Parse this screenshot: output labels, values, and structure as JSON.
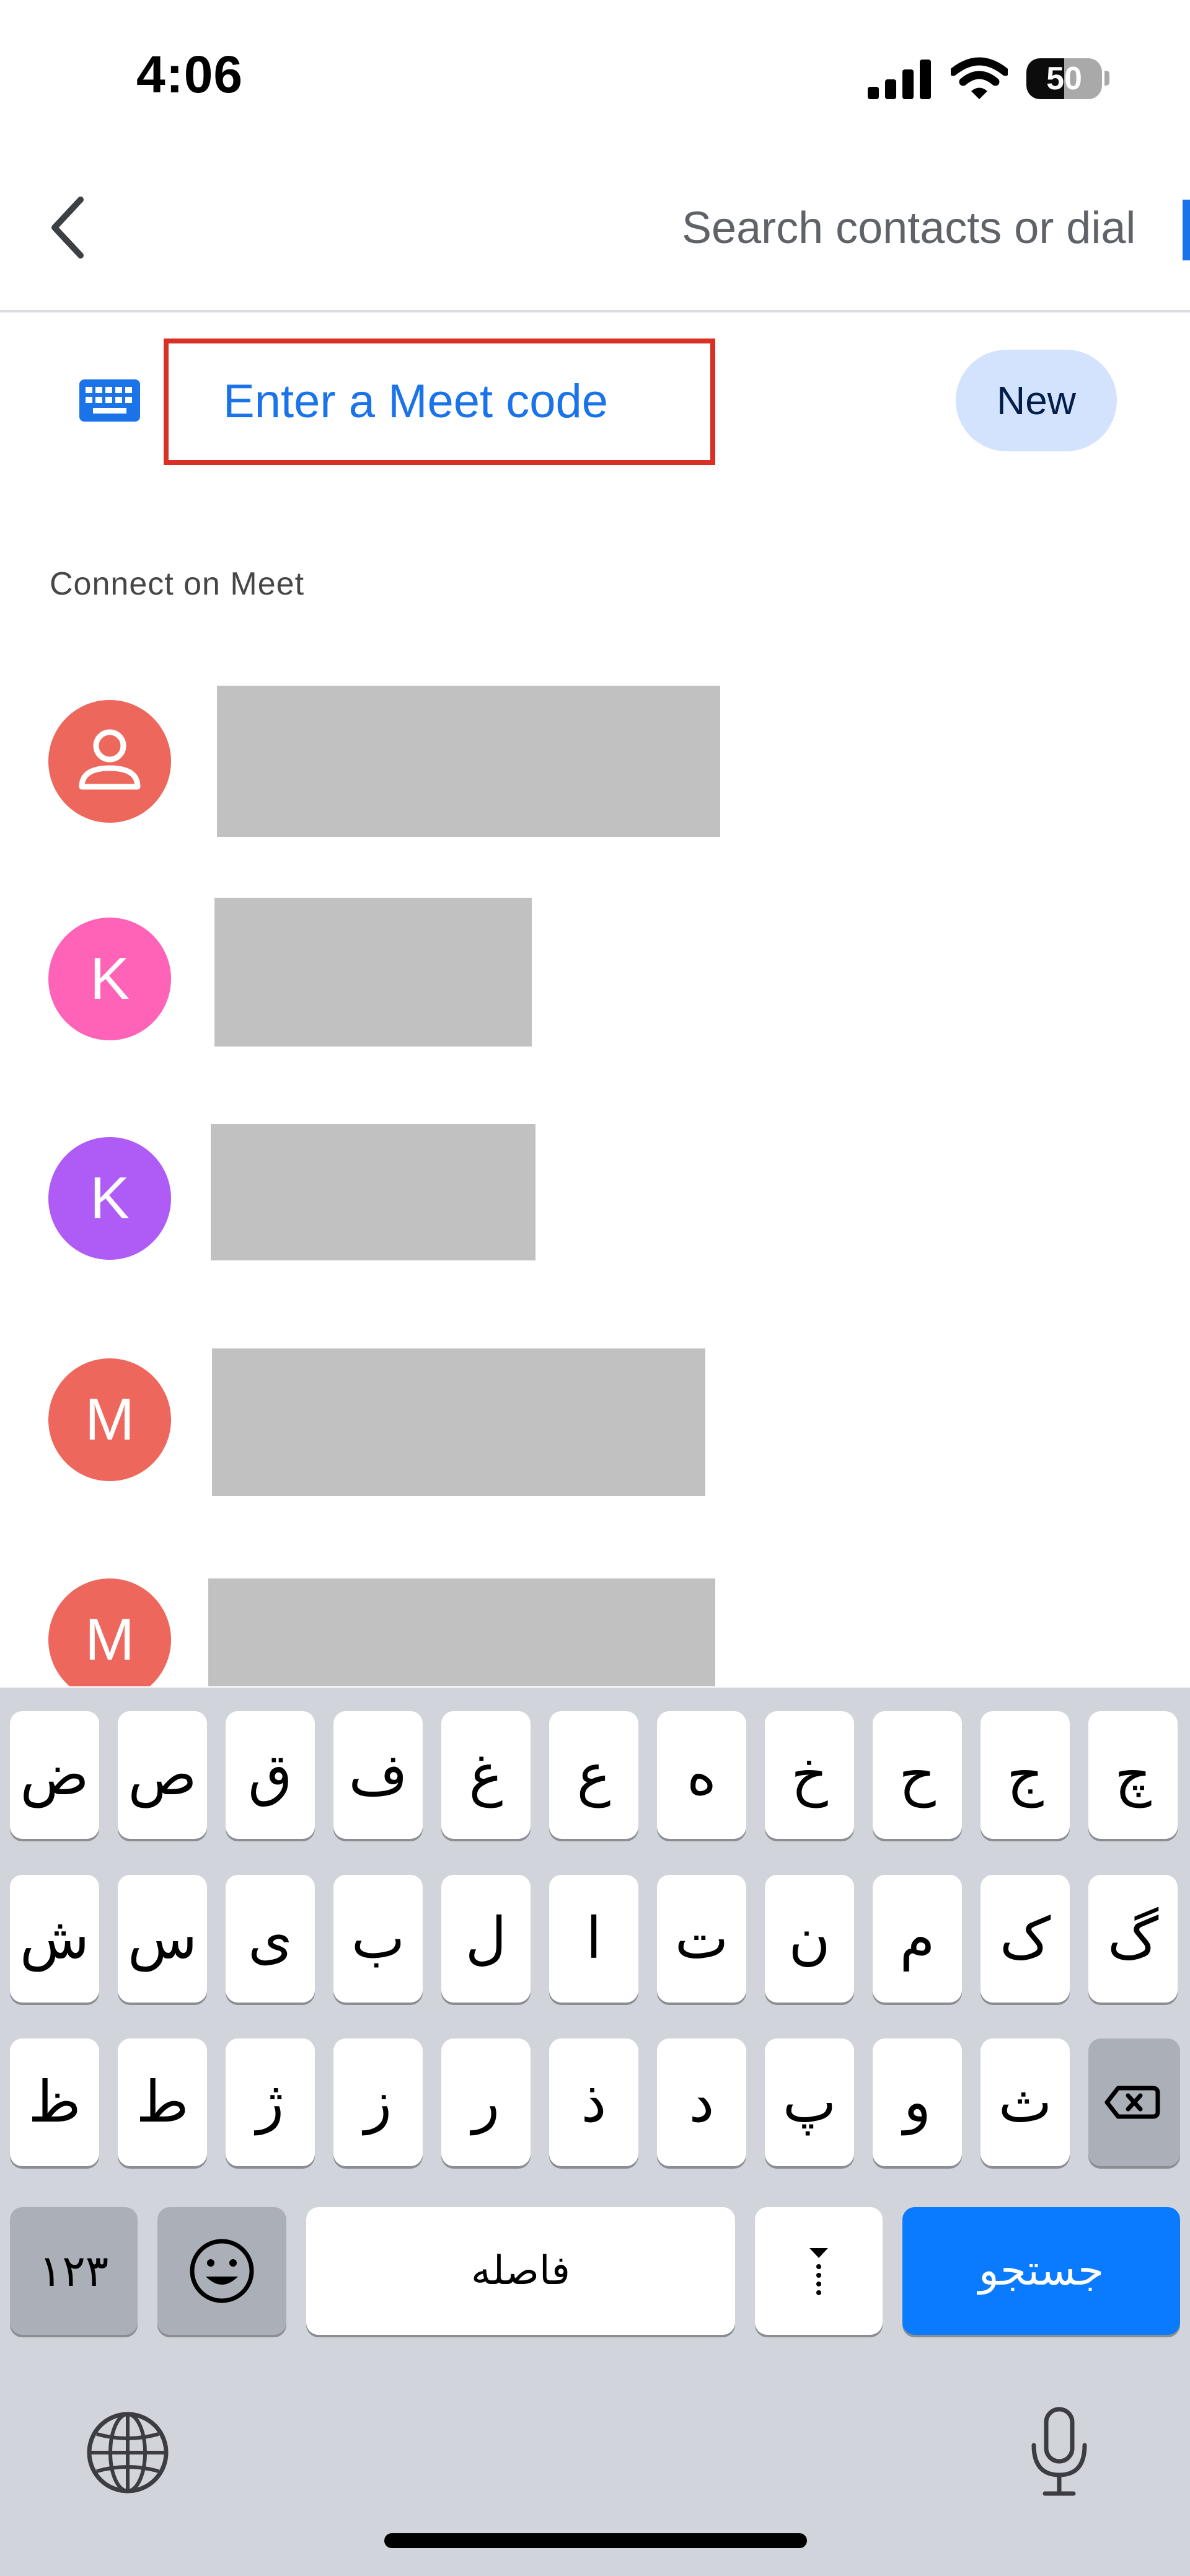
{
  "status_bar": {
    "time": "4:06",
    "battery": {
      "label": "50",
      "level": 0.5
    }
  },
  "header": {
    "back_icon": "chevron-left-icon",
    "search_placeholder": "Search contacts or dial"
  },
  "meet_code": {
    "icon": "keyboard-icon",
    "placeholder": "Enter a Meet code",
    "new_label": "New"
  },
  "section": {
    "title": "Connect on Meet"
  },
  "contacts": [
    {
      "initial": "",
      "icon": "person-icon",
      "color": "#ee675c"
    },
    {
      "initial": "K",
      "color": "#ff63b8"
    },
    {
      "initial": "K",
      "color": "#af5cf7"
    },
    {
      "initial": "M",
      "color": "#ee675c"
    },
    {
      "initial": "M",
      "color": "#ee675c"
    }
  ],
  "keyboard": {
    "row1": [
      "ض",
      "ص",
      "ق",
      "ف",
      "غ",
      "ع",
      "ه",
      "خ",
      "ح",
      "ج",
      "چ"
    ],
    "row2": [
      "ش",
      "س",
      "ی",
      "ب",
      "ل",
      "ا",
      "ت",
      "ن",
      "م",
      "ک",
      "گ"
    ],
    "row3": [
      "ظ",
      "ط",
      "ژ",
      "ز",
      "ر",
      "ذ",
      "د",
      "پ",
      "و",
      "ث"
    ],
    "numbers_label": "۱۲۳",
    "space_label": "فاصله",
    "search_label": "جستجو",
    "delete_icon": "delete-backspace-icon",
    "emoji_icon": "emoji-icon",
    "globe_icon": "globe-icon",
    "mic_icon": "microphone-icon"
  },
  "colors": {
    "accent": "#1a73e8",
    "highlight_border": "#d93025",
    "new_button_bg": "#d3e3fd",
    "keyboard_bg": "#d1d4db",
    "search_key": "#0a7aff"
  }
}
